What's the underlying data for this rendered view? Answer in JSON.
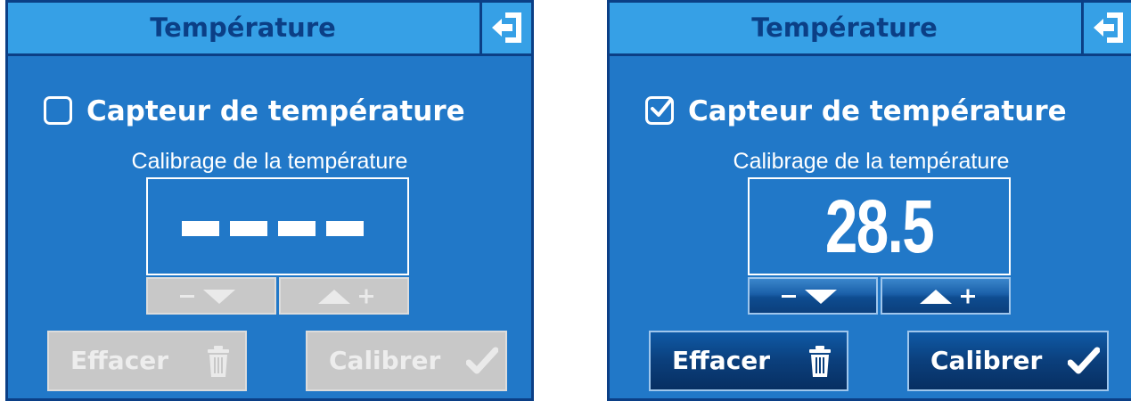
{
  "panels": [
    {
      "title": "Température",
      "checkbox_label": "Capteur de température",
      "checkbox_checked": false,
      "calibration_label": "Calibrage de la température",
      "value_display": "----",
      "enabled": false,
      "buttons": {
        "clear_label": "Effacer",
        "calibrate_label": "Calibrer"
      },
      "icons": {
        "exit": "exit-icon",
        "minus": "minus-icon",
        "down": "triangle-down-icon",
        "up": "triangle-up-icon",
        "plus": "plus-icon",
        "trash": "trash-icon",
        "check": "checkmark-icon"
      }
    },
    {
      "title": "Température",
      "checkbox_label": "Capteur de température",
      "checkbox_checked": true,
      "calibration_label": "Calibrage de la température",
      "value_display": "28.5",
      "enabled": true,
      "buttons": {
        "clear_label": "Effacer",
        "calibrate_label": "Calibrer"
      },
      "icons": {
        "exit": "exit-icon",
        "minus": "minus-icon",
        "down": "triangle-down-icon",
        "up": "triangle-up-icon",
        "plus": "plus-icon",
        "trash": "trash-icon",
        "check": "checkmark-icon"
      }
    }
  ],
  "colors": {
    "panel_bg": "#2178c8",
    "header_bg": "#36a0e6",
    "border": "#0b3f86",
    "disabled_bg": "#c8c8c8",
    "text_white": "#ffffff"
  }
}
